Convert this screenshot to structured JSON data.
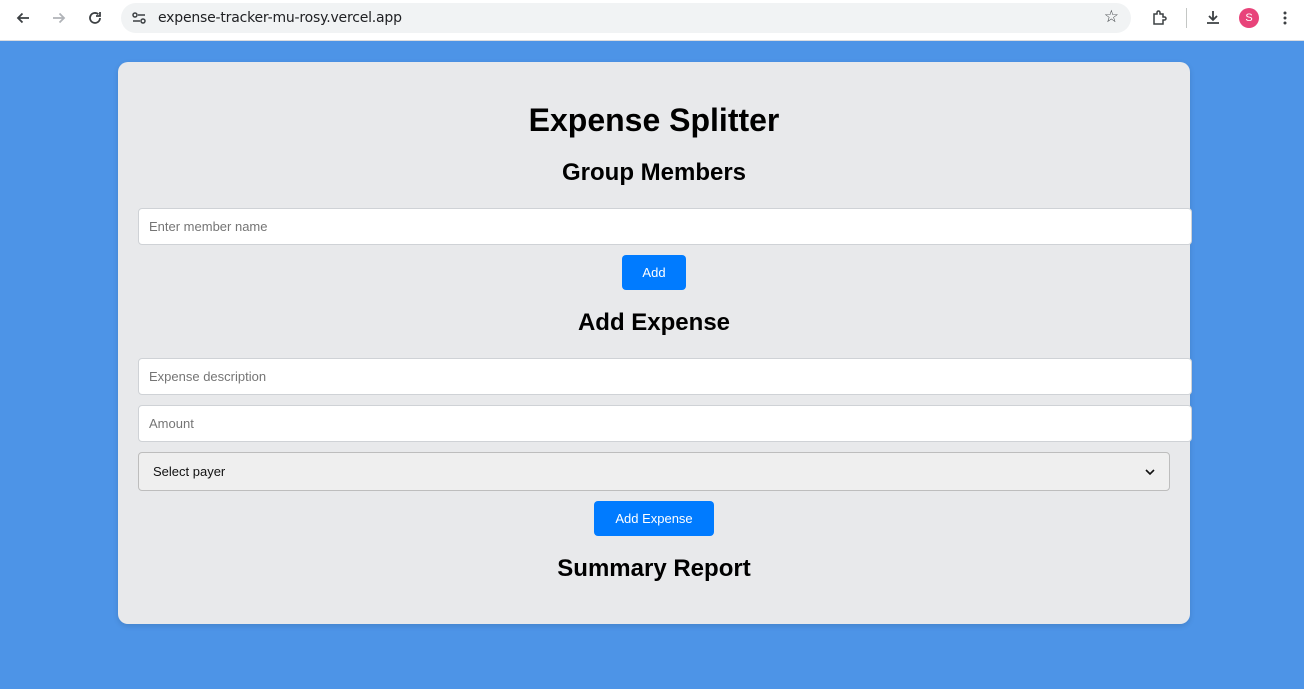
{
  "browser": {
    "url": "expense-tracker-mu-rosy.vercel.app",
    "profile_initial": "S",
    "icons": {
      "back": "back-arrow-icon",
      "forward": "forward-arrow-icon",
      "reload": "reload-icon",
      "site_info": "site-info-icon",
      "bookmark": "star-icon",
      "extensions": "puzzle-icon",
      "downloads": "download-icon",
      "menu": "kebab-menu-icon"
    }
  },
  "app": {
    "title": "Expense Splitter",
    "members": {
      "heading": "Group Members",
      "name_placeholder": "Enter member name",
      "add_label": "Add"
    },
    "expense": {
      "heading": "Add Expense",
      "description_placeholder": "Expense description",
      "amount_placeholder": "Amount",
      "payer_selected": "Select payer",
      "add_label": "Add Expense"
    },
    "summary": {
      "heading": "Summary Report"
    }
  },
  "colors": {
    "page_background": "#4d94e7",
    "card_background": "#e8e9eb",
    "primary_button": "#007bff",
    "avatar": "#e8437a"
  }
}
